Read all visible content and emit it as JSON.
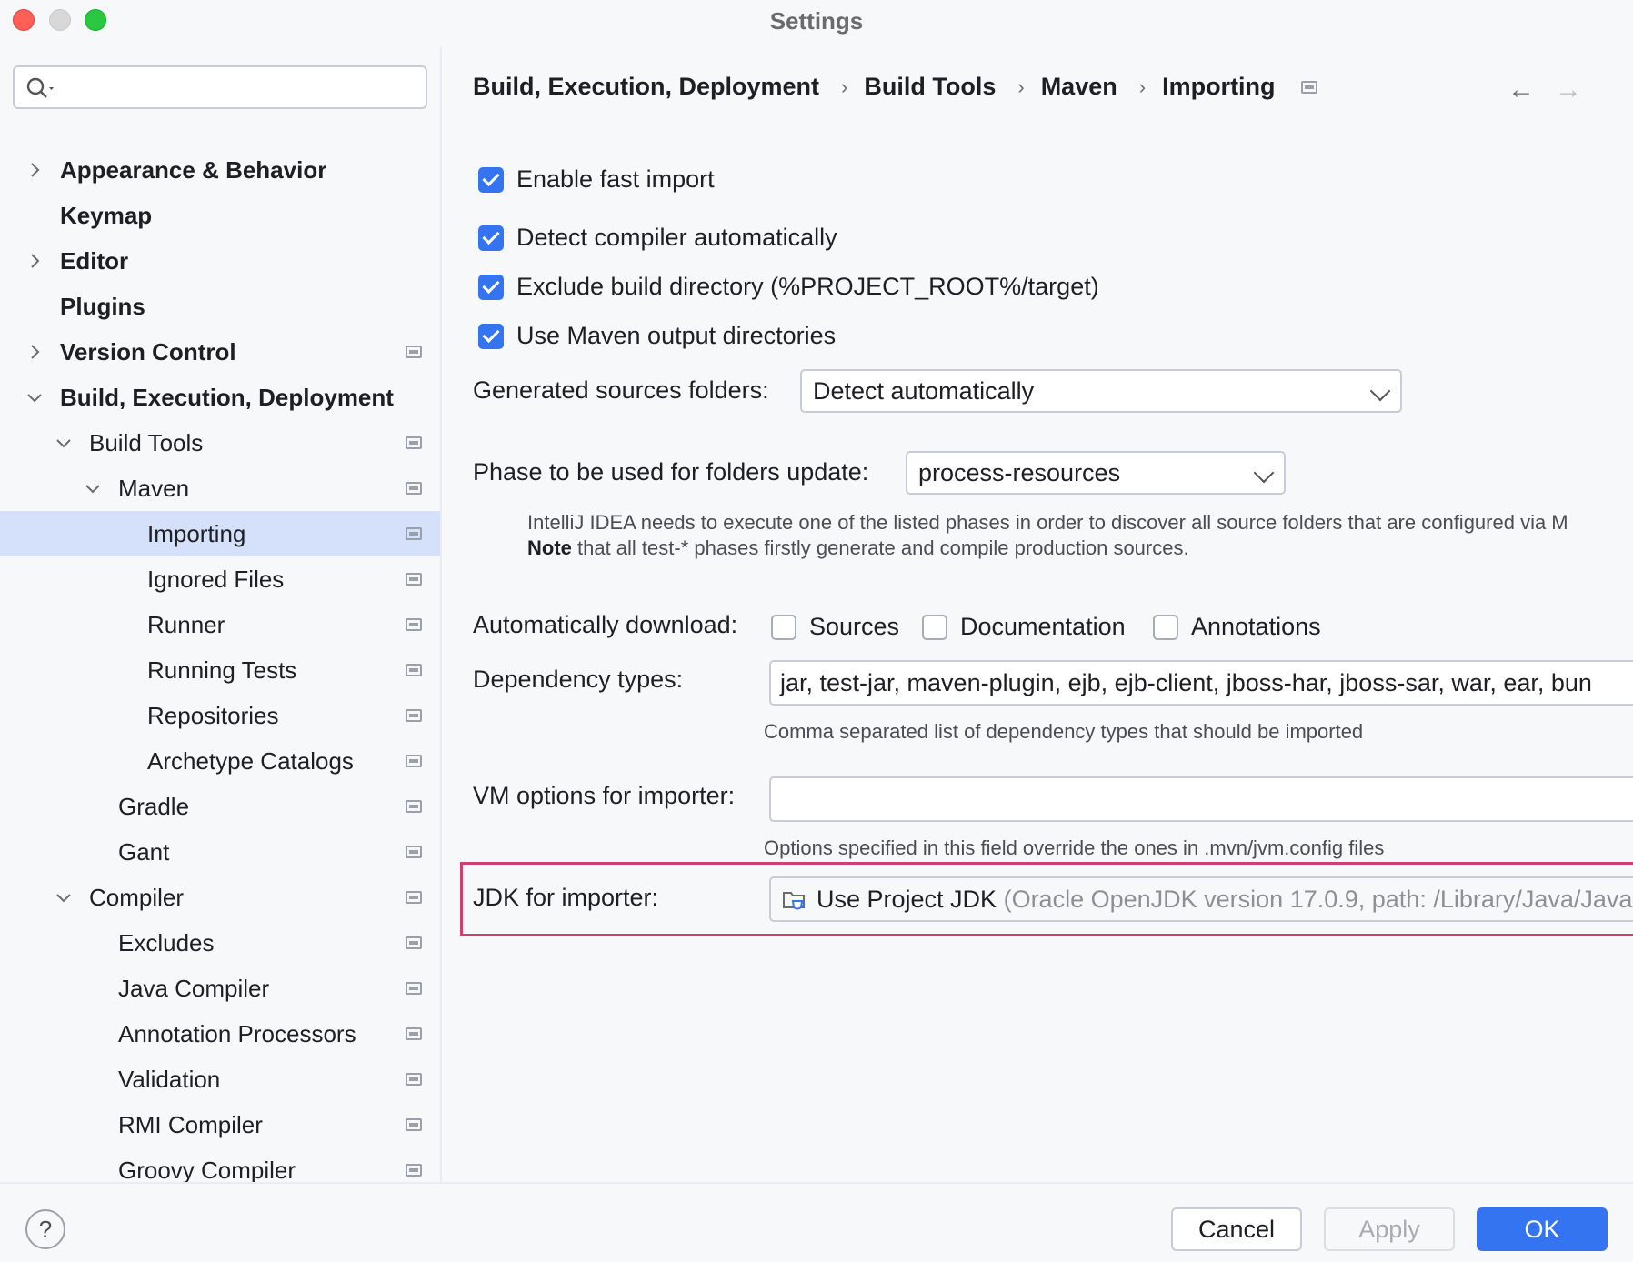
{
  "window": {
    "title": "Settings"
  },
  "sidebar": {
    "search_placeholder": "",
    "items": [
      {
        "label": "Appearance & Behavior",
        "bold": true,
        "expand": "collapsed",
        "depth": 0,
        "page_icon": false
      },
      {
        "label": "Keymap",
        "bold": true,
        "expand": "none",
        "depth": 0,
        "page_icon": false
      },
      {
        "label": "Editor",
        "bold": true,
        "expand": "collapsed",
        "depth": 0,
        "page_icon": false
      },
      {
        "label": "Plugins",
        "bold": true,
        "expand": "none",
        "depth": 0,
        "page_icon": false
      },
      {
        "label": "Version Control",
        "bold": true,
        "expand": "collapsed",
        "depth": 0,
        "page_icon": true
      },
      {
        "label": "Build, Execution, Deployment",
        "bold": true,
        "expand": "expanded",
        "depth": 0,
        "page_icon": false
      },
      {
        "label": "Build Tools",
        "bold": false,
        "expand": "expanded",
        "depth": 1,
        "page_icon": true
      },
      {
        "label": "Maven",
        "bold": false,
        "expand": "expanded",
        "depth": 2,
        "page_icon": true
      },
      {
        "label": "Importing",
        "bold": false,
        "expand": "none",
        "depth": 3,
        "page_icon": true,
        "selected": true
      },
      {
        "label": "Ignored Files",
        "bold": false,
        "expand": "none",
        "depth": 3,
        "page_icon": true
      },
      {
        "label": "Runner",
        "bold": false,
        "expand": "none",
        "depth": 3,
        "page_icon": true
      },
      {
        "label": "Running Tests",
        "bold": false,
        "expand": "none",
        "depth": 3,
        "page_icon": true
      },
      {
        "label": "Repositories",
        "bold": false,
        "expand": "none",
        "depth": 3,
        "page_icon": true
      },
      {
        "label": "Archetype Catalogs",
        "bold": false,
        "expand": "none",
        "depth": 3,
        "page_icon": true
      },
      {
        "label": "Gradle",
        "bold": false,
        "expand": "none",
        "depth": 2,
        "page_icon": true
      },
      {
        "label": "Gant",
        "bold": false,
        "expand": "none",
        "depth": 2,
        "page_icon": true
      },
      {
        "label": "Compiler",
        "bold": false,
        "expand": "expanded",
        "depth": 1,
        "page_icon": true
      },
      {
        "label": "Excludes",
        "bold": false,
        "expand": "none",
        "depth": 2,
        "page_icon": true
      },
      {
        "label": "Java Compiler",
        "bold": false,
        "expand": "none",
        "depth": 2,
        "page_icon": true
      },
      {
        "label": "Annotation Processors",
        "bold": false,
        "expand": "none",
        "depth": 2,
        "page_icon": true
      },
      {
        "label": "Validation",
        "bold": false,
        "expand": "none",
        "depth": 2,
        "page_icon": true
      },
      {
        "label": "RMI Compiler",
        "bold": false,
        "expand": "none",
        "depth": 2,
        "page_icon": true
      },
      {
        "label": "Groovy Compiler",
        "bold": false,
        "expand": "none",
        "depth": 2,
        "page_icon": true
      }
    ]
  },
  "breadcrumb": [
    "Build, Execution, Deployment",
    "Build Tools",
    "Maven",
    "Importing"
  ],
  "breadcrumb_separator": "›",
  "nav": {
    "back": "←",
    "forward": "→"
  },
  "settings": {
    "checkboxes": [
      {
        "label": "Enable fast import",
        "checked": true
      },
      {
        "label": "Detect compiler automatically",
        "checked": true
      },
      {
        "label": "Exclude build directory (%PROJECT_ROOT%/target)",
        "checked": true
      },
      {
        "label": "Use Maven output directories",
        "checked": true
      }
    ],
    "generated_sources": {
      "label": "Generated sources folders:",
      "value": "Detect automatically"
    },
    "phase": {
      "label": "Phase to be used for folders update:",
      "value": "process-resources",
      "hint_line1": "IntelliJ IDEA needs to execute one of the listed phases in order to discover all source folders that are configured via M",
      "hint_note_bold": "Note",
      "hint_line2": " that all test-* phases firstly generate and compile production sources."
    },
    "auto_download": {
      "label": "Automatically download:",
      "options": [
        {
          "label": "Sources",
          "checked": false
        },
        {
          "label": "Documentation",
          "checked": false
        },
        {
          "label": "Annotations",
          "checked": false
        }
      ]
    },
    "dependency_types": {
      "label": "Dependency types:",
      "value": "jar, test-jar, maven-plugin, ejb, ejb-client, jboss-har, jboss-sar, war, ear, bun",
      "hint": "Comma separated list of dependency types that should be imported"
    },
    "vm_options": {
      "label": "VM options for importer:",
      "value": "",
      "hint": "Options specified in this field override the ones in .mvn/jvm.config files"
    },
    "jdk": {
      "label": "JDK for importer:",
      "value": "Use Project JDK",
      "detail": "(Oracle OpenJDK version 17.0.9, path: /Library/Java/Java"
    }
  },
  "buttons": {
    "help": "?",
    "cancel": "Cancel",
    "apply": "Apply",
    "ok": "OK"
  },
  "colors": {
    "accent": "#3574f0",
    "highlight_border": "#d13f6e",
    "selection": "#d5e1fb"
  }
}
